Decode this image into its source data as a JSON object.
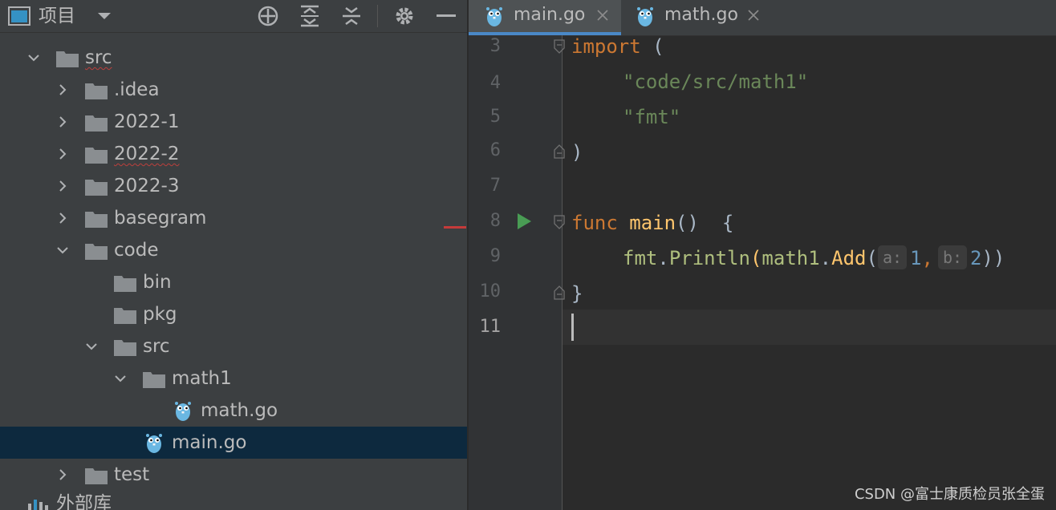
{
  "project_panel": {
    "title": "项目",
    "header_icons": [
      "project-view-icon",
      "dropdown-icon",
      "locate-icon",
      "expand-all-icon",
      "collapse-all-icon",
      "settings-gear-icon",
      "minimize-icon"
    ],
    "tree": [
      {
        "label": "src",
        "type": "folder",
        "expanded": true,
        "error": true
      },
      {
        "label": ".idea",
        "type": "folder",
        "expanded": false
      },
      {
        "label": "2022-1",
        "type": "folder",
        "expanded": false
      },
      {
        "label": "2022-2",
        "type": "folder",
        "expanded": false,
        "error": true
      },
      {
        "label": "2022-3",
        "type": "folder",
        "expanded": false
      },
      {
        "label": "basegram",
        "type": "folder",
        "expanded": false
      },
      {
        "label": "code",
        "type": "folder",
        "expanded": true
      },
      {
        "label": "bin",
        "type": "folder"
      },
      {
        "label": "pkg",
        "type": "folder"
      },
      {
        "label": "src",
        "type": "folder",
        "expanded": true
      },
      {
        "label": "math1",
        "type": "folder",
        "expanded": true
      },
      {
        "label": "math.go",
        "type": "go-file"
      },
      {
        "label": "main.go",
        "type": "go-file",
        "selected": true
      },
      {
        "label": "test",
        "type": "folder",
        "expanded": false
      }
    ],
    "external_libraries": "外部库"
  },
  "tabs": [
    {
      "label": "main.go",
      "active": true
    },
    {
      "label": "math.go",
      "active": false
    }
  ],
  "editor": {
    "line_numbers": [
      "3",
      "4",
      "5",
      "6",
      "7",
      "8",
      "9",
      "10",
      "11"
    ],
    "code": {
      "l3_kw": "import",
      "l3_rest": " (",
      "l4": "\"code/src/math1\"",
      "l5": "\"fmt\"",
      "l6": ")",
      "l8_kw": "func",
      "l8_fn": "main",
      "l8_rest": "()  {",
      "l9_pkg": "fmt",
      "l9_dot1": ".",
      "l9_fn1": "Println",
      "l9_paren": "(",
      "l9_pkg2": "math1",
      "l9_dot2": ".",
      "l9_fn2": "Add",
      "l9_paren2": "(",
      "l9_hint_a": "a:",
      "l9_val_a": "1",
      "l9_comma": ",",
      "l9_hint_b": "b:",
      "l9_val_b": "2",
      "l9_close": "))",
      "l10": "}"
    },
    "current_line": "11"
  },
  "watermark": "CSDN @富士康质检员张全蛋",
  "colors": {
    "keyword": "#cc7832",
    "string": "#6a8759",
    "function": "#ffc66d",
    "number": "#6897bb",
    "selection": "#0d293e",
    "tab_underline": "#4a88c7",
    "run_icon": "#499c54",
    "error_mark": "#c53a3a"
  }
}
